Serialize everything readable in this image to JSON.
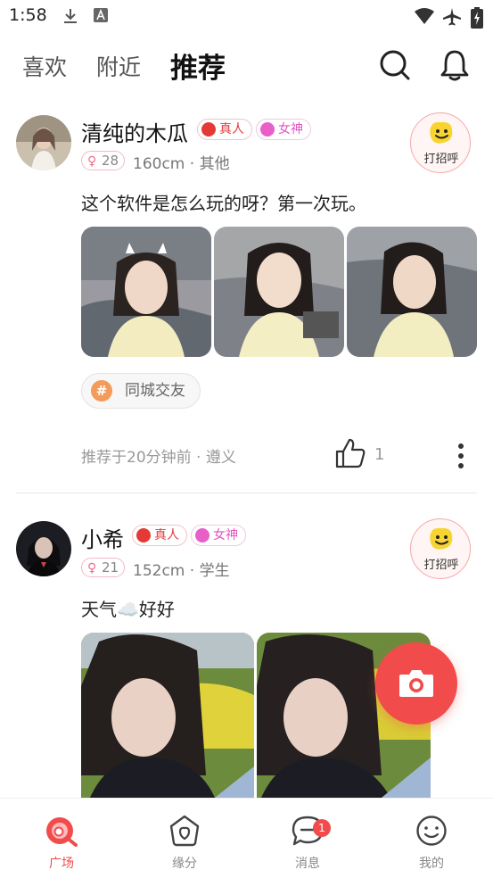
{
  "status_bar": {
    "time": "1:58"
  },
  "top_nav": {
    "tabs": [
      {
        "label": "喜欢",
        "active": false
      },
      {
        "label": "附近",
        "active": false
      },
      {
        "label": "推荐",
        "active": true
      }
    ]
  },
  "posts": [
    {
      "name": "清纯的木瓜",
      "badges": {
        "real": "真人",
        "goddess": "女神"
      },
      "age": "28",
      "meta": "160cm · 其他",
      "greet_label": "打招呼",
      "text": "这个软件是怎么玩的呀？第一次玩。",
      "photo_count": 3,
      "topic": "同城交友",
      "footer": "推荐于20分钟前 · 遵义",
      "likes": "1"
    },
    {
      "name": "小希",
      "badges": {
        "real": "真人",
        "goddess": "女神"
      },
      "age": "21",
      "meta": "152cm · 学生",
      "greet_label": "打招呼",
      "text": "天气☁️好好",
      "photo_count": 2
    }
  ],
  "bottom_nav": {
    "items": [
      {
        "label": "广场",
        "icon": "plaza-icon",
        "active": true
      },
      {
        "label": "缘分",
        "icon": "fate-icon",
        "active": false
      },
      {
        "label": "消息",
        "icon": "message-icon",
        "active": false,
        "badge": "1"
      },
      {
        "label": "我的",
        "icon": "profile-icon",
        "active": false
      }
    ]
  },
  "colors": {
    "accent": "#f24b4b",
    "real_badge": "#e53935",
    "goddess_badge": "#e85fc8"
  }
}
